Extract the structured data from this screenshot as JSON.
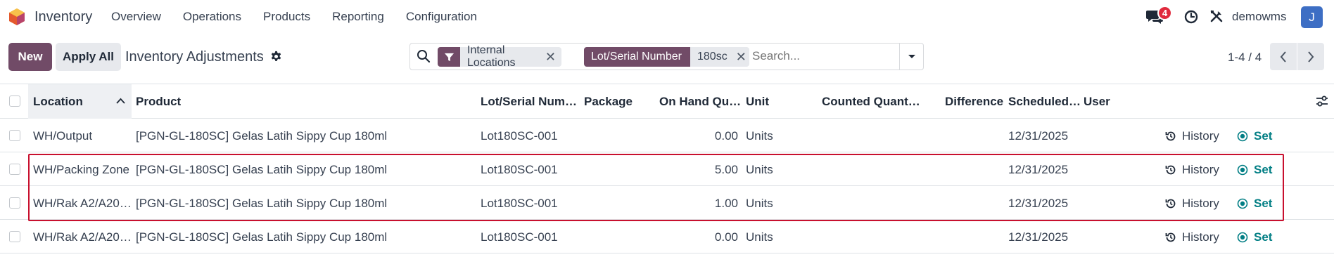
{
  "navbar": {
    "app_name": "Inventory",
    "menu": [
      "Overview",
      "Operations",
      "Products",
      "Reporting",
      "Configuration"
    ],
    "chat_count": "4",
    "username": "demowms",
    "avatar_initial": "J"
  },
  "control_panel": {
    "new_label": "New",
    "apply_all_label": "Apply All",
    "title": "Inventory Adjustments"
  },
  "search": {
    "facets": [
      {
        "tag": "",
        "value": "Internal Locations"
      },
      {
        "tag": "Lot/Serial Number",
        "value": "180sc"
      }
    ],
    "placeholder": "Search..."
  },
  "pager": {
    "value": "1-4 / 4"
  },
  "table": {
    "columns": [
      "Location",
      "Product",
      "Lot/Serial Num…",
      "Package",
      "On Hand Qu…",
      "Unit",
      "Counted Quant…",
      "Difference",
      "Scheduled…",
      "User"
    ],
    "rows": [
      {
        "location": "WH/Output",
        "product": "[PGN-GL-180SC] Gelas Latih Sippy Cup 180ml",
        "lot": "Lot180SC-001",
        "package": "",
        "on_hand": "0.00",
        "unit": "Units",
        "counted": "",
        "difference": "",
        "scheduled": "12/31/2025",
        "user": "",
        "history": "History",
        "set": "Set"
      },
      {
        "location": "WH/Packing Zone",
        "product": "[PGN-GL-180SC] Gelas Latih Sippy Cup 180ml",
        "lot": "Lot180SC-001",
        "package": "",
        "on_hand": "5.00",
        "unit": "Units",
        "counted": "",
        "difference": "",
        "scheduled": "12/31/2025",
        "user": "",
        "history": "History",
        "set": "Set"
      },
      {
        "location": "WH/Rak A2/A20…",
        "product": "[PGN-GL-180SC] Gelas Latih Sippy Cup 180ml",
        "lot": "Lot180SC-001",
        "package": "",
        "on_hand": "1.00",
        "unit": "Units",
        "counted": "",
        "difference": "",
        "scheduled": "12/31/2025",
        "user": "",
        "history": "History",
        "set": "Set"
      },
      {
        "location": "WH/Rak A2/A20…",
        "product": "[PGN-GL-180SC] Gelas Latih Sippy Cup 180ml",
        "lot": "Lot180SC-001",
        "package": "",
        "on_hand": "0.00",
        "unit": "Units",
        "counted": "",
        "difference": "",
        "scheduled": "12/31/2025",
        "user": "",
        "history": "History",
        "set": "Set"
      }
    ]
  },
  "colors": {
    "brand": "#714b67",
    "accent_teal": "#017e84",
    "badge_red": "#e02a3d",
    "highlight_red": "#c8102e",
    "avatar_blue": "#3d6ec4"
  },
  "icons": {
    "app": "inventory-logo-icon",
    "chat": "chat-icon",
    "activity": "clock-icon",
    "debug": "tools-icon",
    "settings": "gear-icon",
    "search": "search-icon",
    "filter": "filter-icon",
    "history": "history-icon",
    "set": "target-icon",
    "optional_columns": "sliders-icon"
  }
}
